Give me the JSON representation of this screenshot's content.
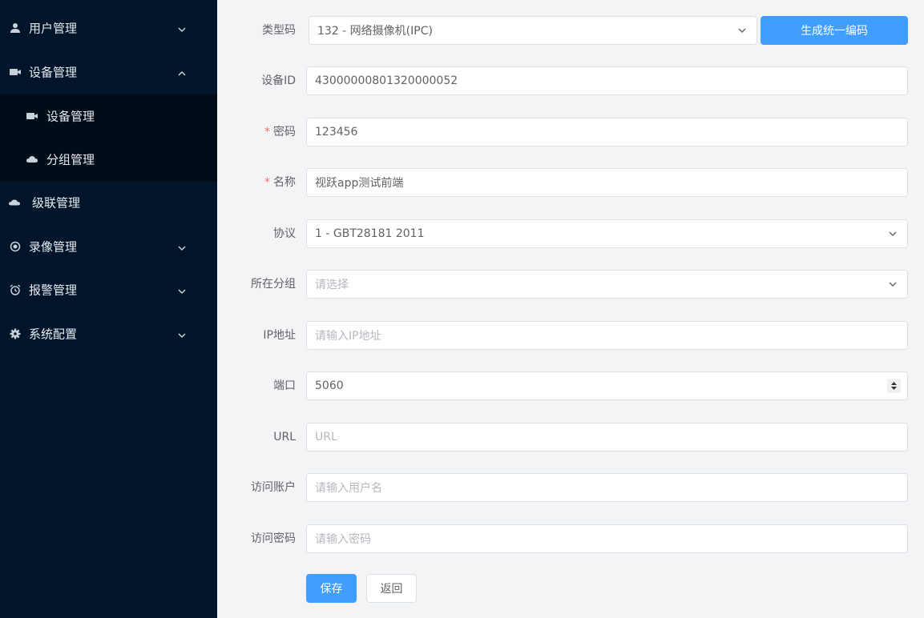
{
  "sidebar": {
    "items": [
      {
        "label": "用户管理",
        "icon": "user-icon"
      },
      {
        "label": "设备管理",
        "icon": "camera-icon"
      },
      {
        "label": "级联管理",
        "icon": "cloud-icon"
      },
      {
        "label": "录像管理",
        "icon": "record-icon"
      },
      {
        "label": "报警管理",
        "icon": "alarm-clock-icon"
      },
      {
        "label": "系统配置",
        "icon": "gear-icon"
      }
    ],
    "subitems": [
      {
        "label": "设备管理",
        "icon": "camera-icon"
      },
      {
        "label": "分组管理",
        "icon": "cloud-icon"
      }
    ]
  },
  "form": {
    "type_code": {
      "label": "类型码",
      "value": "132 - 网络摄像机(IPC)"
    },
    "generate_button": "生成统一编码",
    "device_id": {
      "label": "设备ID",
      "value": "43000000801320000052"
    },
    "password": {
      "label": "密码",
      "required": "*",
      "value": "123456"
    },
    "name": {
      "label": "名称",
      "required": "*",
      "value": "视跃app测试前端"
    },
    "protocol": {
      "label": "协议",
      "value": "1 - GBT28181 2011"
    },
    "group": {
      "label": "所在分组",
      "placeholder": "请选择"
    },
    "ip": {
      "label": "IP地址",
      "placeholder": "请输入IP地址"
    },
    "port": {
      "label": "端口",
      "value": "5060"
    },
    "url": {
      "label": "URL",
      "placeholder": "URL"
    },
    "account": {
      "label": "访问账户",
      "placeholder": "请输入用户名"
    },
    "access_password": {
      "label": "访问密码",
      "placeholder": "请输入密码"
    },
    "save_button": "保存",
    "back_button": "返回"
  }
}
